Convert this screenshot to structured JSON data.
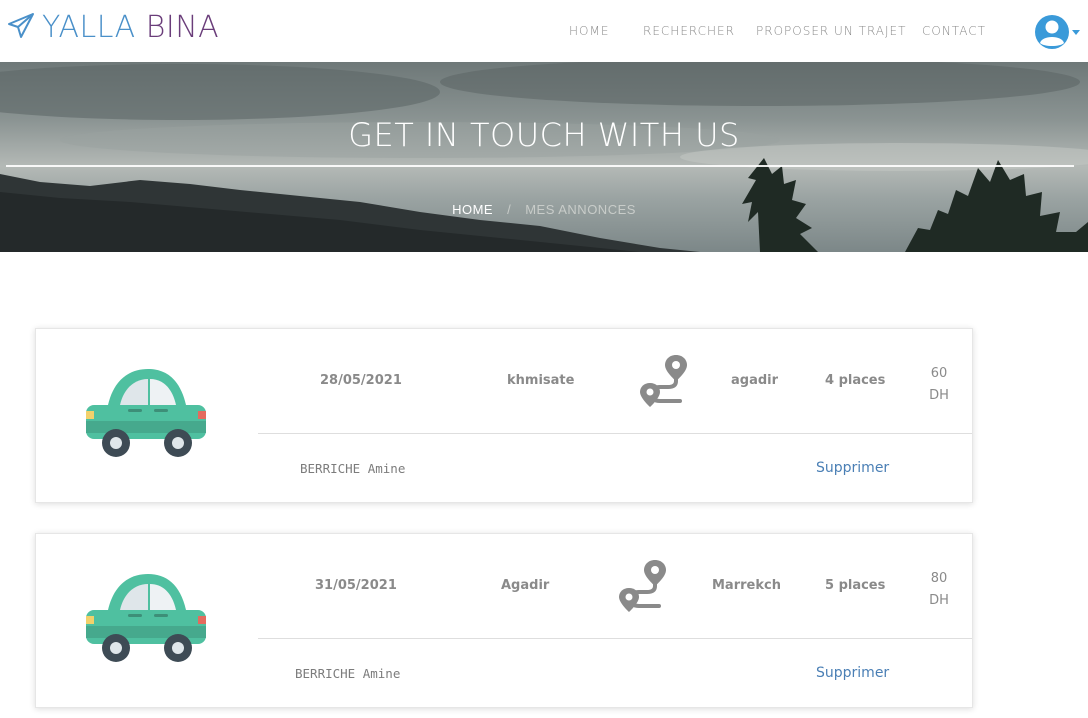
{
  "brand": {
    "part1": "YALLA",
    "part2": "BINA",
    "icon": "paper-plane-icon"
  },
  "nav": {
    "items": [
      {
        "label": "HOME"
      },
      {
        "label": "RECHERCHER"
      },
      {
        "label": "PROPOSER UN TRAJET"
      },
      {
        "label": "CONTACT"
      }
    ],
    "user_icon": "user-circle-icon"
  },
  "hero": {
    "title": "GET IN TOUCH WITH US",
    "breadcrumb": {
      "home": "HOME",
      "separator": "/",
      "current": "MES ANNONCES"
    }
  },
  "trips": [
    {
      "date": "28/05/2021",
      "from": "khmisate",
      "to": "agadir",
      "places": "4 places",
      "price_amount": "60",
      "price_currency": "DH",
      "driver": "BERRICHE Amine",
      "delete_label": "Supprimer"
    },
    {
      "date": "31/05/2021",
      "from": "Agadir",
      "to": "Marrekch",
      "places": "5 places",
      "price_amount": "80",
      "price_currency": "DH",
      "driver": "BERRICHE Amine",
      "delete_label": "Supprimer"
    }
  ],
  "colors": {
    "brand_blue": "#4a90c9",
    "brand_purple": "#6a3d7a",
    "car_green": "#4fc0a0",
    "link_blue": "#4a7fb5"
  }
}
